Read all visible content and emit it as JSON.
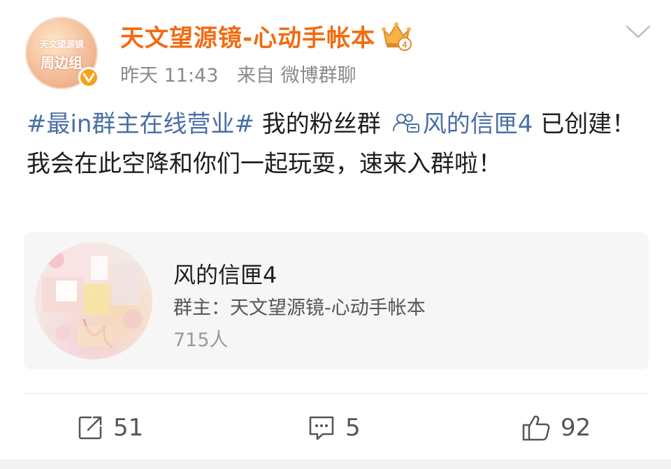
{
  "user": {
    "name": "天文望源镜-心动手帐本",
    "avatar_text_line1": "天文望源镜",
    "avatar_text_line2": "周边组",
    "badge_number": "4"
  },
  "meta": {
    "time": "昨天 11:43",
    "source": "来自 微博群聊"
  },
  "post": {
    "hashtag": "#最in群主在线营业#",
    "text_before_link": " 我的粉丝群",
    "group_link": "风的信匣4",
    "text_after_link": " 已创建！我会在此空降和你们一起玩耍，速来入群啦！"
  },
  "group_card": {
    "title": "风的信匣4",
    "owner": "群主：天文望源镜-心动手帐本",
    "members": "715人"
  },
  "actions": {
    "repost_count": "51",
    "comment_count": "5",
    "like_count": "92"
  },
  "colors": {
    "name": "#f26b11",
    "link": "#4a6fa5",
    "meta": "#8a8a8a",
    "verified": "#f7a21b"
  }
}
